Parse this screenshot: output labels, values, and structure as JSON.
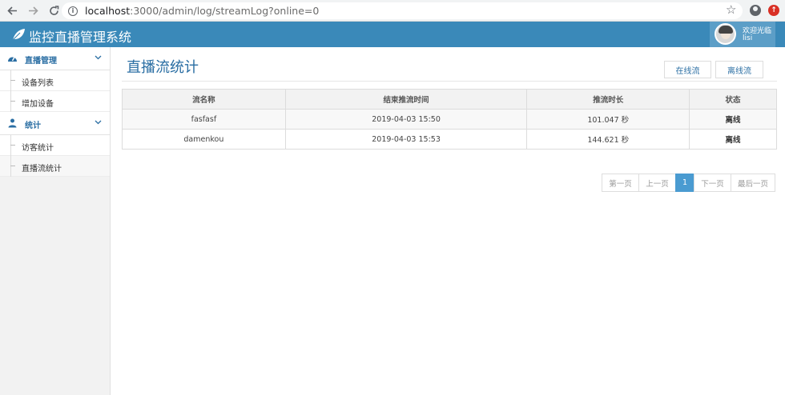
{
  "browser": {
    "url_host": "localhost",
    "url_path": ":3000/admin/log/streamLog?online=0"
  },
  "header": {
    "title": "监控直播管理系统",
    "user_greeting": "欢迎光临",
    "user_name": "lisi"
  },
  "sidebar": {
    "groups": [
      {
        "label": "直播管理",
        "items": [
          {
            "label": "设备列表"
          },
          {
            "label": "增加设备"
          }
        ]
      },
      {
        "label": "统计",
        "items": [
          {
            "label": "访客统计"
          },
          {
            "label": "直播流统计"
          }
        ]
      }
    ]
  },
  "main": {
    "title": "直播流统计",
    "online_button": "在线流",
    "offline_button": "离线流",
    "columns": [
      "流名称",
      "结束推流时间",
      "推流时长",
      "状态"
    ],
    "rows": [
      {
        "name": "fasfasf",
        "end_time": "2019-04-03 15:50",
        "duration": "101.047 秒",
        "status": "离线"
      },
      {
        "name": "damenkou",
        "end_time": "2019-04-03 15:53",
        "duration": "144.621 秒",
        "status": "离线"
      }
    ]
  },
  "pagination": {
    "first": "第一页",
    "prev": "上一页",
    "current": "1",
    "next": "下一页",
    "last": "最后一页"
  },
  "colors": {
    "header_bg": "#3a89b9",
    "accent": "#2a6ea3",
    "page_active": "#4a9bd1"
  }
}
